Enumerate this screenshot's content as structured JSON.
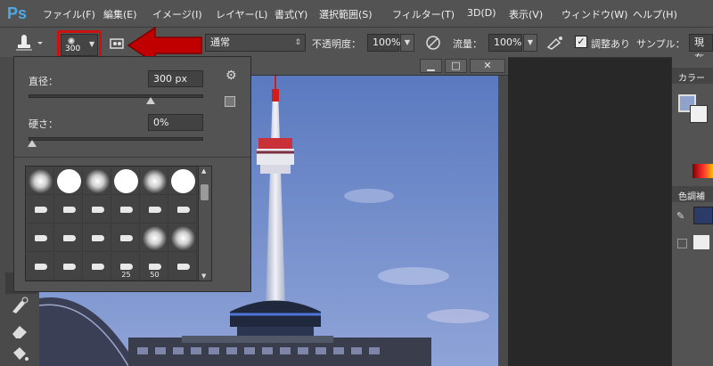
{
  "app": {
    "logo": "Ps"
  },
  "menu": [
    "ファイル(F)",
    "編集(E)",
    "イメージ(I)",
    "レイヤー(L)",
    "書式(Y)",
    "選択範囲(S)",
    "フィルター(T)",
    "3D(D)",
    "表示(V)",
    "ウィンドウ(W)",
    "ヘルプ(H)"
  ],
  "options_bar": {
    "brush_size": "300",
    "mode": "通常",
    "opacity_label": "不透明度：",
    "opacity_value": "100%",
    "flow_label": "流量：",
    "flow_value": "100%",
    "sample_check_label": "調整あり",
    "sample_check_checked": true,
    "sample_label": "サンプル：",
    "sample_value": "現在"
  },
  "brush_popup": {
    "diameter_label": "直径：",
    "diameter_value": "300 px",
    "hardness_label": "硬さ：",
    "hardness_value": "0%",
    "diameter_slider": 0.7,
    "hardness_slider": 0.0,
    "presets": [
      {
        "kind": "soft"
      },
      {
        "kind": "hard"
      },
      {
        "kind": "soft"
      },
      {
        "kind": "hard"
      },
      {
        "kind": "soft"
      },
      {
        "kind": "hard"
      },
      {
        "kind": "tip"
      },
      {
        "kind": "tip"
      },
      {
        "kind": "tip"
      },
      {
        "kind": "tip"
      },
      {
        "kind": "tip"
      },
      {
        "kind": "tip"
      },
      {
        "kind": "tip"
      },
      {
        "kind": "tip"
      },
      {
        "kind": "tip"
      },
      {
        "kind": "tip"
      },
      {
        "kind": "soft"
      },
      {
        "kind": "soft"
      },
      {
        "kind": "tip"
      },
      {
        "kind": "tip"
      },
      {
        "kind": "tip"
      },
      {
        "kind": "tip",
        "label": "25"
      },
      {
        "kind": "tip",
        "label": "50"
      },
      {
        "kind": "tip"
      }
    ]
  },
  "doc_window": {
    "min": "▁",
    "max": "□",
    "close": "✕"
  },
  "right_panel": {
    "color_tab": "カラー",
    "adjust_tab": "色調補"
  },
  "colors": {
    "chrome": "#535353",
    "dark": "#282828",
    "highlight": "#cc1111",
    "arrow": "#c00000",
    "sky_top": "#5a79bf",
    "sky_bottom": "#8fa4d8"
  }
}
